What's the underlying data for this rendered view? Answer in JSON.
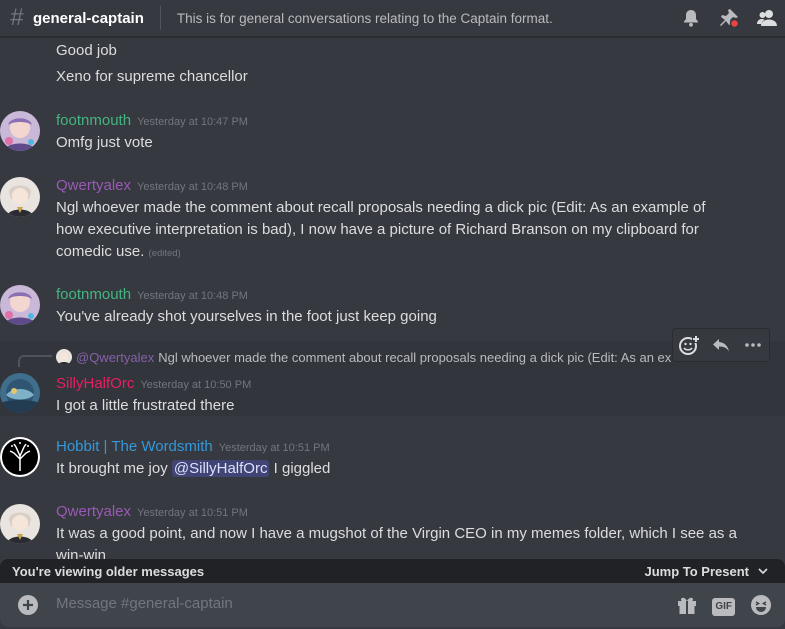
{
  "header": {
    "channel_name": "general-captain",
    "topic": "This is for general conversations relating to the Captain format.",
    "icons": [
      "bell-icon",
      "pin-icon",
      "members-icon"
    ]
  },
  "messages": [
    {
      "text": "Good job"
    },
    {
      "text": "Xeno for supreme chancellor"
    },
    {
      "author": "footnmouth",
      "author_color": "#43b581",
      "timestamp": "Yesterday at 10:47 PM",
      "text": "Omfg just vote"
    },
    {
      "author": "Qwertyalex",
      "author_color": "#9b59b6",
      "timestamp": "Yesterday at 10:48 PM",
      "text_line1": "Ngl whoever made the comment about recall proposals needing a dick pic (Edit: As an example of",
      "text_line2": "how executive interpretation is bad), I now have a picture of Richard Branson on my clipboard for",
      "text_line3": "comedic use.",
      "edited": "(edited)"
    },
    {
      "author": "footnmouth",
      "author_color": "#43b581",
      "timestamp": "Yesterday at 10:48 PM",
      "text": "You've already shot yourselves in the foot just keep going"
    },
    {
      "reply_to_name": "@Qwertyalex",
      "reply_to_text": "Ngl whoever made the comment about recall proposals needing a dick pic (Edit: As an ex",
      "author": "SillyHalfOrc",
      "author_color": "#e91e63",
      "timestamp": "Yesterday at 10:50 PM",
      "text": "I got a little frustrated there"
    },
    {
      "author": "Hobbit | The Wordsmith",
      "author_color": "#3498db",
      "timestamp": "Yesterday at 10:51 PM",
      "text_before": "It brought me joy",
      "mention": "@SillyHalfOrc",
      "text_after": "I giggled"
    },
    {
      "author": "Qwertyalex",
      "author_color": "#9b59b6",
      "timestamp": "Yesterday at 10:51 PM",
      "text_line1": "It was a good point, and now I have a mugshot of the Virgin CEO in my memes folder, which I see as a",
      "text_line2": "win-win"
    }
  ],
  "message_toolbar": {
    "icons": [
      "add-reaction-icon",
      "reply-icon",
      "more-icon"
    ]
  },
  "older_bar": {
    "label": "You're viewing older messages",
    "jump_label": "Jump To Present"
  },
  "composer": {
    "placeholder": "Message #general-captain",
    "gif_label": "GIF",
    "icons": [
      "plus-icon",
      "gift-icon",
      "gif-icon",
      "emoji-icon"
    ]
  }
}
